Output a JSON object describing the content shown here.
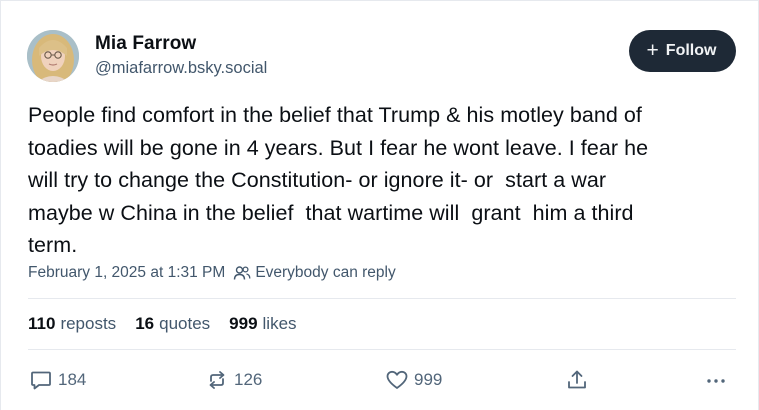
{
  "author": {
    "display_name": "Mia Farrow",
    "handle": "@miafarrow.bsky.social",
    "avatar_icon": "avatar-photo"
  },
  "follow_button": {
    "icon": "plus-icon",
    "plus_glyph": "+",
    "label": "Follow"
  },
  "post": {
    "text": "People find comfort in the belief that Trump & his motley band of\ntoadies will be gone in 4 years. But I fear he wont leave. I fear he\nwill try to change the Constitution- or ignore it- or  start a war\nmaybe w China in the belief  that wartime will  grant  him a third\nterm.",
    "timestamp": "February 1, 2025 at 1:31 PM",
    "reply_setting": "Everybody can reply",
    "reply_setting_icon": "people-icon"
  },
  "stats": {
    "reposts_count": "110",
    "reposts_label": "reposts",
    "quotes_count": "16",
    "quotes_label": "quotes",
    "likes_count": "999",
    "likes_label": "likes"
  },
  "actions": {
    "reply_count": "184",
    "repost_count": "126",
    "like_count": "999",
    "reply_icon": "speech-bubble-icon",
    "repost_icon": "repost-arrows-icon",
    "like_icon": "heart-icon",
    "share_icon": "share-icon",
    "more_icon": "ellipsis-icon"
  },
  "colors": {
    "text": "#0b0f14",
    "secondary_text": "#42576c",
    "follow_bg": "#1e2936",
    "divider": "#e6e9ee"
  }
}
